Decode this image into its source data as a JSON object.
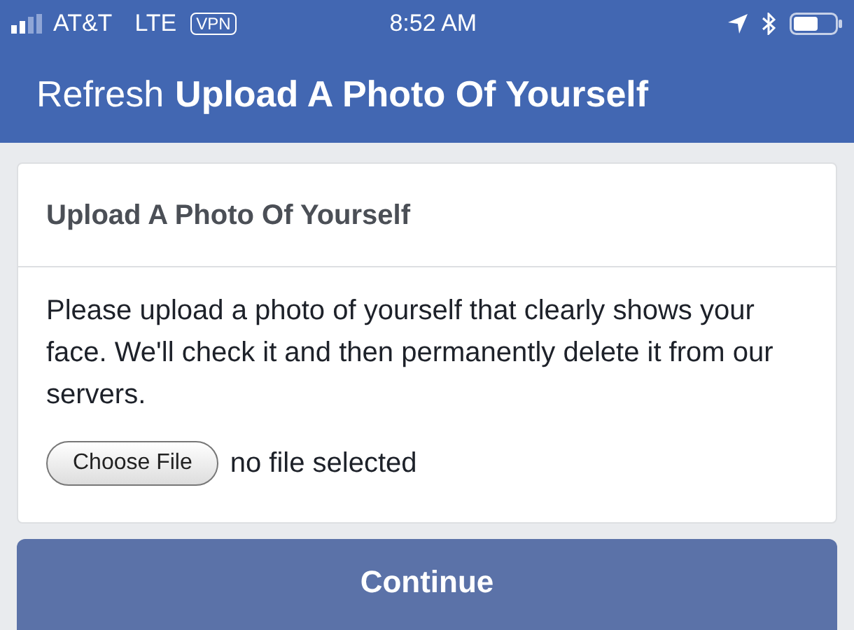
{
  "status_bar": {
    "carrier": "AT&T",
    "network": "LTE",
    "vpn": "VPN",
    "time": "8:52 AM"
  },
  "header": {
    "refresh": "Refresh",
    "title": "Upload A Photo Of Yourself"
  },
  "card": {
    "title": "Upload A Photo Of Yourself",
    "message": "Please upload a photo of yourself that clearly shows your face. We'll check it and then permanently delete it from our servers.",
    "file_button": "Choose File",
    "file_status": "no file selected"
  },
  "continue_button": "Continue"
}
